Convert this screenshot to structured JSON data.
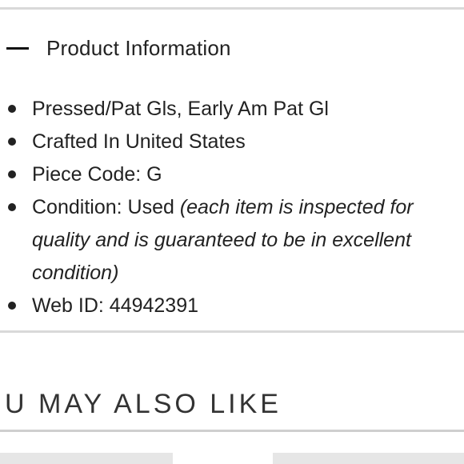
{
  "product_info": {
    "title": "Product Information",
    "icon": "minus-icon",
    "items": [
      {
        "text": "Pressed/Pat Gls, Early Am Pat Gl"
      },
      {
        "text": "Crafted In United States"
      },
      {
        "text": "Piece Code: G"
      },
      {
        "text": "Condition: Used ",
        "note": "(each item is inspected for quality and is guaranteed to be in excellent condition)"
      },
      {
        "text": "Web ID: 44942391"
      }
    ]
  },
  "recommendations": {
    "heading": "U MAY ALSO LIKE"
  },
  "colors": {
    "text": "#222222",
    "divider": "#d9d9d9",
    "placeholder": "#e6e6e6"
  }
}
